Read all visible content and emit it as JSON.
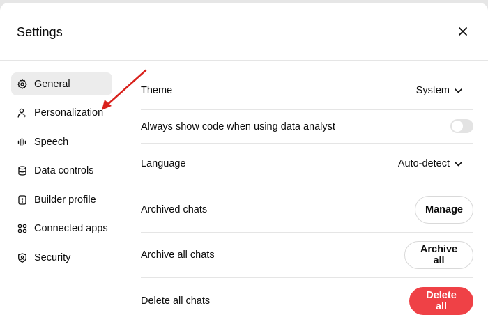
{
  "dialog": {
    "title": "Settings"
  },
  "sidebar": {
    "items": [
      {
        "label": "General",
        "icon": "gear-icon",
        "active": true
      },
      {
        "label": "Personalization",
        "icon": "person-icon",
        "active": false
      },
      {
        "label": "Speech",
        "icon": "waveform-icon",
        "active": false
      },
      {
        "label": "Data controls",
        "icon": "database-icon",
        "active": false
      },
      {
        "label": "Builder profile",
        "icon": "badge-icon",
        "active": false
      },
      {
        "label": "Connected apps",
        "icon": "apps-grid-icon",
        "active": false
      },
      {
        "label": "Security",
        "icon": "shield-icon",
        "active": false
      }
    ]
  },
  "general": {
    "theme": {
      "label": "Theme",
      "value": "System"
    },
    "code_toggle": {
      "label": "Always show code when using data analyst",
      "on": false
    },
    "language": {
      "label": "Language",
      "value": "Auto-detect"
    },
    "archived": {
      "label": "Archived chats",
      "button": "Manage"
    },
    "archive_all": {
      "label": "Archive all chats",
      "button": "Archive all"
    },
    "delete_all": {
      "label": "Delete all chats",
      "button": "Delete all"
    }
  },
  "colors": {
    "accent_danger": "#ef4146",
    "annotation_arrow": "#d9211c",
    "active_nav_bg": "#ececec"
  }
}
